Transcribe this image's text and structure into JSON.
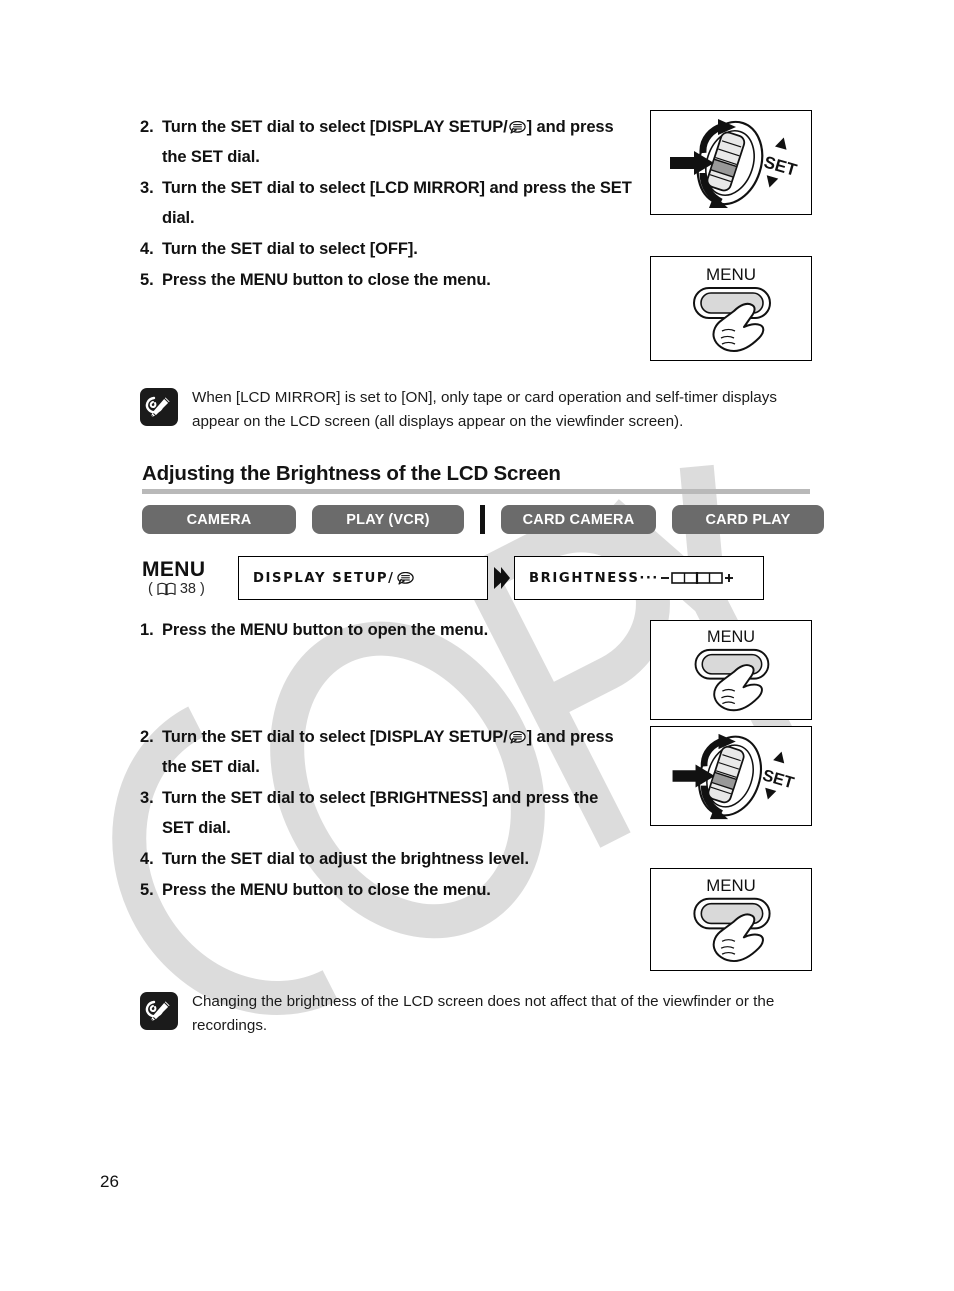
{
  "page": {
    "number": "26"
  },
  "top_section": {
    "steps": [
      {
        "num": "2.",
        "text_before": "Turn the SET dial to select [DISPLAY SETUP/",
        "icon": "display-setup-icon",
        "text_after": "] and press the SET dial."
      },
      {
        "num": "3.",
        "text_before": "Turn the SET dial to select [LCD MIRROR] and press the SET dial.",
        "icon": "",
        "text_after": ""
      },
      {
        "num": "4.",
        "text_before": "Turn the SET dial to select [OFF].",
        "icon": "",
        "text_after": ""
      },
      {
        "num": "5.",
        "text_before": "Press the MENU button to close the menu.",
        "icon": "",
        "text_after": ""
      }
    ],
    "illustrations": [
      {
        "name": "set-dial-illustration",
        "label": "SET"
      },
      {
        "name": "menu-button-illustration",
        "label": "MENU"
      }
    ],
    "note": "When [LCD MIRROR] is set to [ON], only tape or card operation and self-timer displays appear on the LCD screen (all displays appear on the viewfinder screen)."
  },
  "section": {
    "heading": "Adjusting the Brightness of the LCD Screen",
    "tabs": [
      {
        "label": "CAMERA",
        "name": "tab-camera"
      },
      {
        "label": "PLAY (VCR)",
        "name": "tab-play-vcr"
      },
      {
        "label": "CARD CAMERA",
        "name": "tab-card-camera"
      },
      {
        "label": "CARD PLAY",
        "name": "tab-card-play"
      }
    ],
    "menu_path": {
      "menu_word": "MENU",
      "ref_open": "(",
      "ref_page": "38",
      "ref_close": ")",
      "box1": "DISPLAY SETUP/",
      "box2": "BRIGHTNESS",
      "box2_dots": "···",
      "slider_minus": "–",
      "slider_plus": "+"
    },
    "steps": [
      {
        "num": "1.",
        "text_before": "Press the MENU button to open the menu.",
        "icon": "",
        "text_after": ""
      },
      {
        "num": "2.",
        "text_before": "Turn the SET dial to select [DISPLAY SETUP/",
        "icon": "display-setup-icon",
        "text_after": "] and press the SET dial."
      },
      {
        "num": "3.",
        "text_before": "Turn the SET dial to select [BRIGHTNESS] and press the SET dial.",
        "icon": "",
        "text_after": ""
      },
      {
        "num": "4.",
        "text_before": "Turn the SET dial to adjust the brightness level.",
        "icon": "",
        "text_after": ""
      },
      {
        "num": "5.",
        "text_before": "Press the MENU button to close the menu.",
        "icon": "",
        "text_after": ""
      }
    ],
    "illustrations": [
      {
        "name": "menu-button-illustration",
        "label": "MENU"
      },
      {
        "name": "set-dial-illustration",
        "label": "SET"
      },
      {
        "name": "menu-button-illustration",
        "label": "MENU"
      }
    ],
    "note": "Changing the brightness of the LCD screen does not affect that of the viewfinder or the recordings."
  },
  "watermark": {
    "text": "COPY",
    "color": "#dcdcdc"
  },
  "colors": {
    "tab_background": "#6b6b6b",
    "tab_text": "#ffffff",
    "heading_rule": "#b9b9b9",
    "note_icon_background": "#1b1b1b"
  }
}
